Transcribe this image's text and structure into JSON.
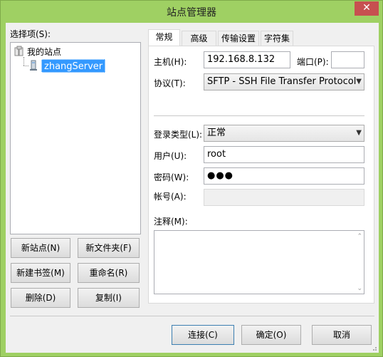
{
  "window": {
    "title": "站点管理器",
    "close_glyph": "✕"
  },
  "left": {
    "select_label": "选择项(S):",
    "tree_root": "我的站点",
    "tree_child": "zhangServer",
    "buttons": {
      "new_site": "新站点(N)",
      "new_folder": "新文件夹(F)",
      "new_bookmark": "新建书签(M)",
      "rename": "重命名(R)",
      "delete": "删除(D)",
      "copy": "复制(I)"
    }
  },
  "tabs": [
    "常规",
    "高级",
    "传输设置",
    "字符集"
  ],
  "general": {
    "host_label": "主机(H):",
    "host_value": "192.168.8.132",
    "port_label": "端口(P):",
    "port_value": "",
    "protocol_label": "协议(T):",
    "protocol_value": "SFTP - SSH File Transfer Protocol",
    "logon_label": "登录类型(L):",
    "logon_value": "正常",
    "user_label": "用户(U):",
    "user_value": "root",
    "password_label": "密码(W):",
    "password_value": "●●●",
    "account_label": "帐号(A):",
    "account_value": "",
    "comments_label": "注释(M):"
  },
  "footer": {
    "connect": "连接(C)",
    "ok": "确定(O)",
    "cancel": "取消"
  }
}
